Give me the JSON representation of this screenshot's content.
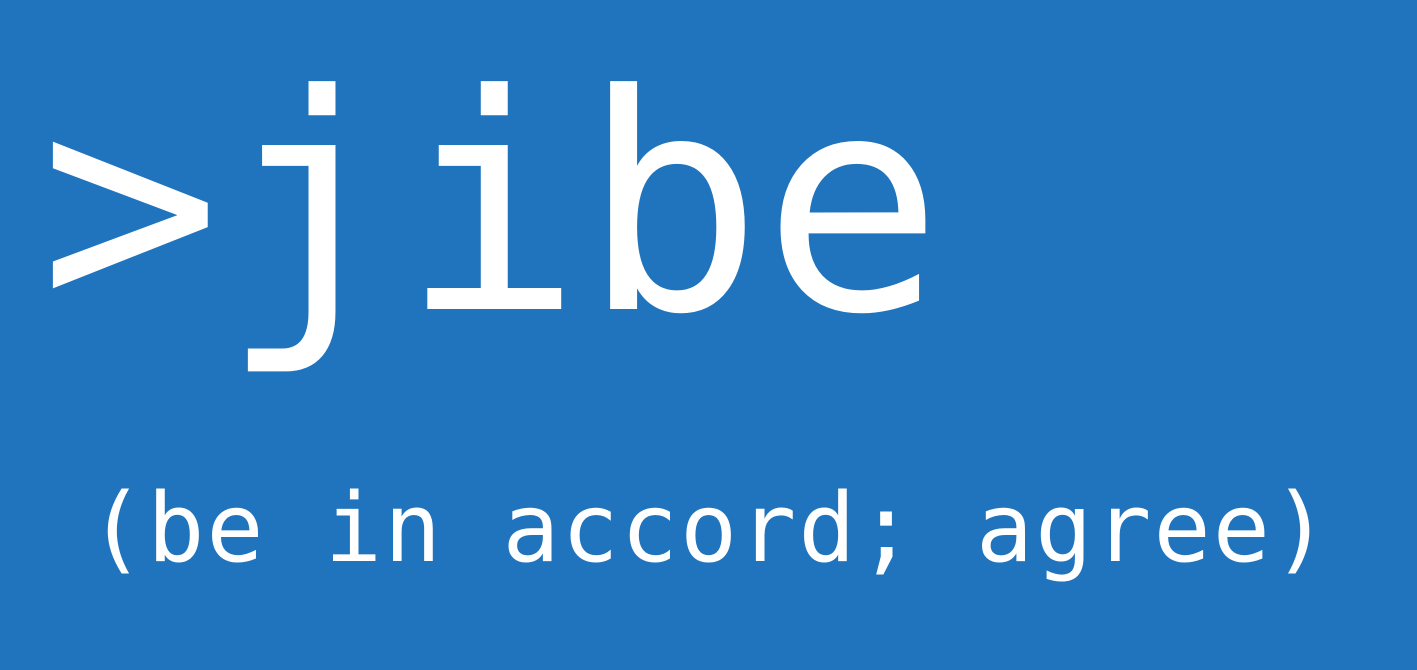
{
  "brand": {
    "prompt_symbol": ">",
    "name": "jibe",
    "tagline": "(be in accord; agree)"
  },
  "colors": {
    "background": "#1f74bd",
    "text": "#ffffff"
  }
}
